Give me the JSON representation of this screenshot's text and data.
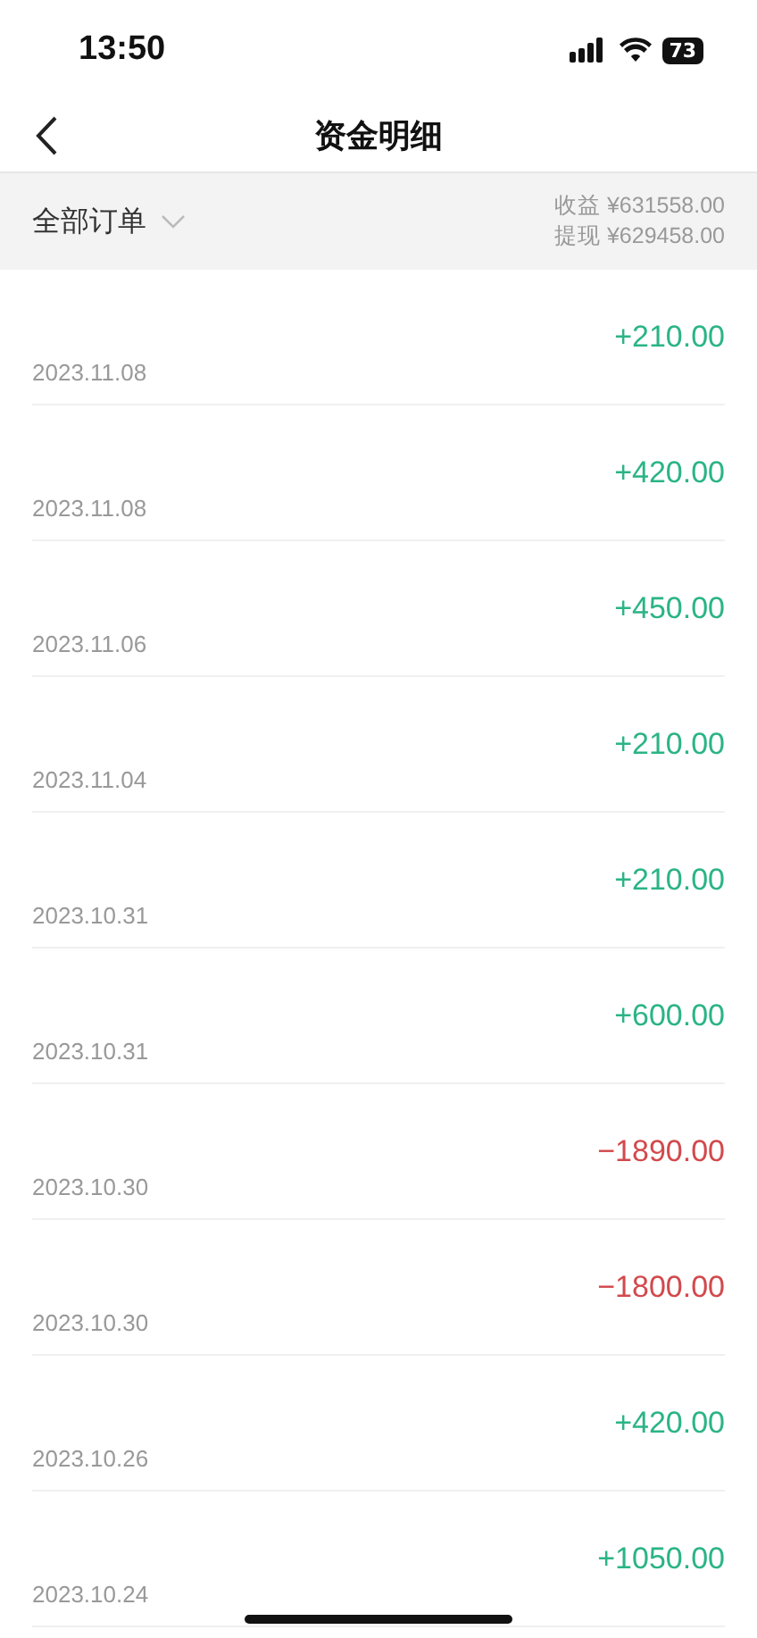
{
  "status_bar": {
    "time": "13:50",
    "battery": "73"
  },
  "header": {
    "title": "资金明细"
  },
  "filter": {
    "label": "全部订单",
    "income_label": "收益 ¥631558.00",
    "withdraw_label": "提现 ¥629458.00"
  },
  "rows": [
    {
      "date": "2023.11.08",
      "amount": "+210.00",
      "kind": "income"
    },
    {
      "date": "2023.11.08",
      "amount": "+420.00",
      "kind": "income"
    },
    {
      "date": "2023.11.06",
      "amount": "+450.00",
      "kind": "income"
    },
    {
      "date": "2023.11.04",
      "amount": "+210.00",
      "kind": "income"
    },
    {
      "date": "2023.10.31",
      "amount": "+210.00",
      "kind": "income"
    },
    {
      "date": "2023.10.31",
      "amount": "+600.00",
      "kind": "income"
    },
    {
      "date": "2023.10.30",
      "amount": "−1890.00",
      "kind": "expense"
    },
    {
      "date": "2023.10.30",
      "amount": "−1800.00",
      "kind": "expense"
    },
    {
      "date": "2023.10.26",
      "amount": "+420.00",
      "kind": "income"
    },
    {
      "date": "2023.10.24",
      "amount": "+1050.00",
      "kind": "income"
    }
  ]
}
